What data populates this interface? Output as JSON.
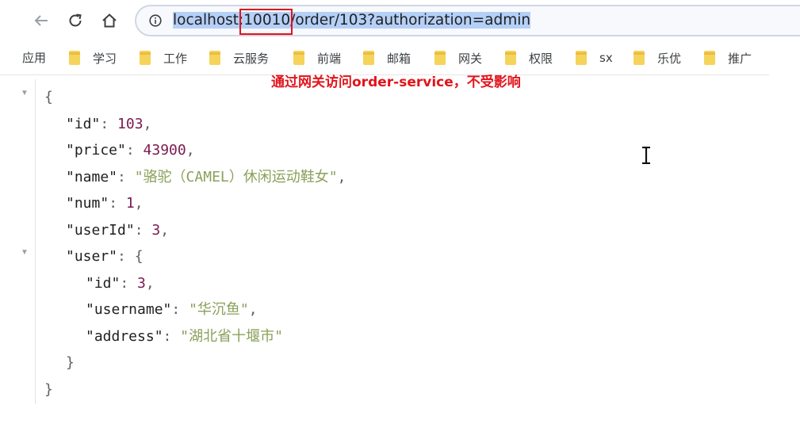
{
  "nav": {
    "back_icon": "arrow-left-icon",
    "reload_icon": "reload-icon",
    "home_icon": "home-icon"
  },
  "address_bar": {
    "host": "localhost",
    "port": "10010",
    "path": "/order/103?authorization=admin"
  },
  "bookmarks": {
    "apps_label": "应用",
    "items": [
      "学习",
      "工作",
      "云服务",
      "前端",
      "邮箱",
      "网关",
      "权限",
      "sx",
      "乐优",
      "推广"
    ]
  },
  "annotation": "通过网关访问order-service，不受影响",
  "json": {
    "id_key": "\"id\"",
    "id_val": "103",
    "price_key": "\"price\"",
    "price_val": "43900",
    "name_key": "\"name\"",
    "name_val": "\"骆驼（CAMEL）休闲运动鞋女\"",
    "num_key": "\"num\"",
    "num_val": "1",
    "userId_key": "\"userId\"",
    "userId_val": "3",
    "user_key": "\"user\"",
    "user_id_key": "\"id\"",
    "user_id_val": "3",
    "username_key": "\"username\"",
    "username_val": "\"华沉鱼\"",
    "address_key": "\"address\"",
    "address_val": "\"湖北省十堰市\""
  },
  "colors": {
    "highlight": "#e3131b",
    "selection": "#b5d0f7",
    "number": "#7a1a4f",
    "string": "#8ba05a"
  }
}
